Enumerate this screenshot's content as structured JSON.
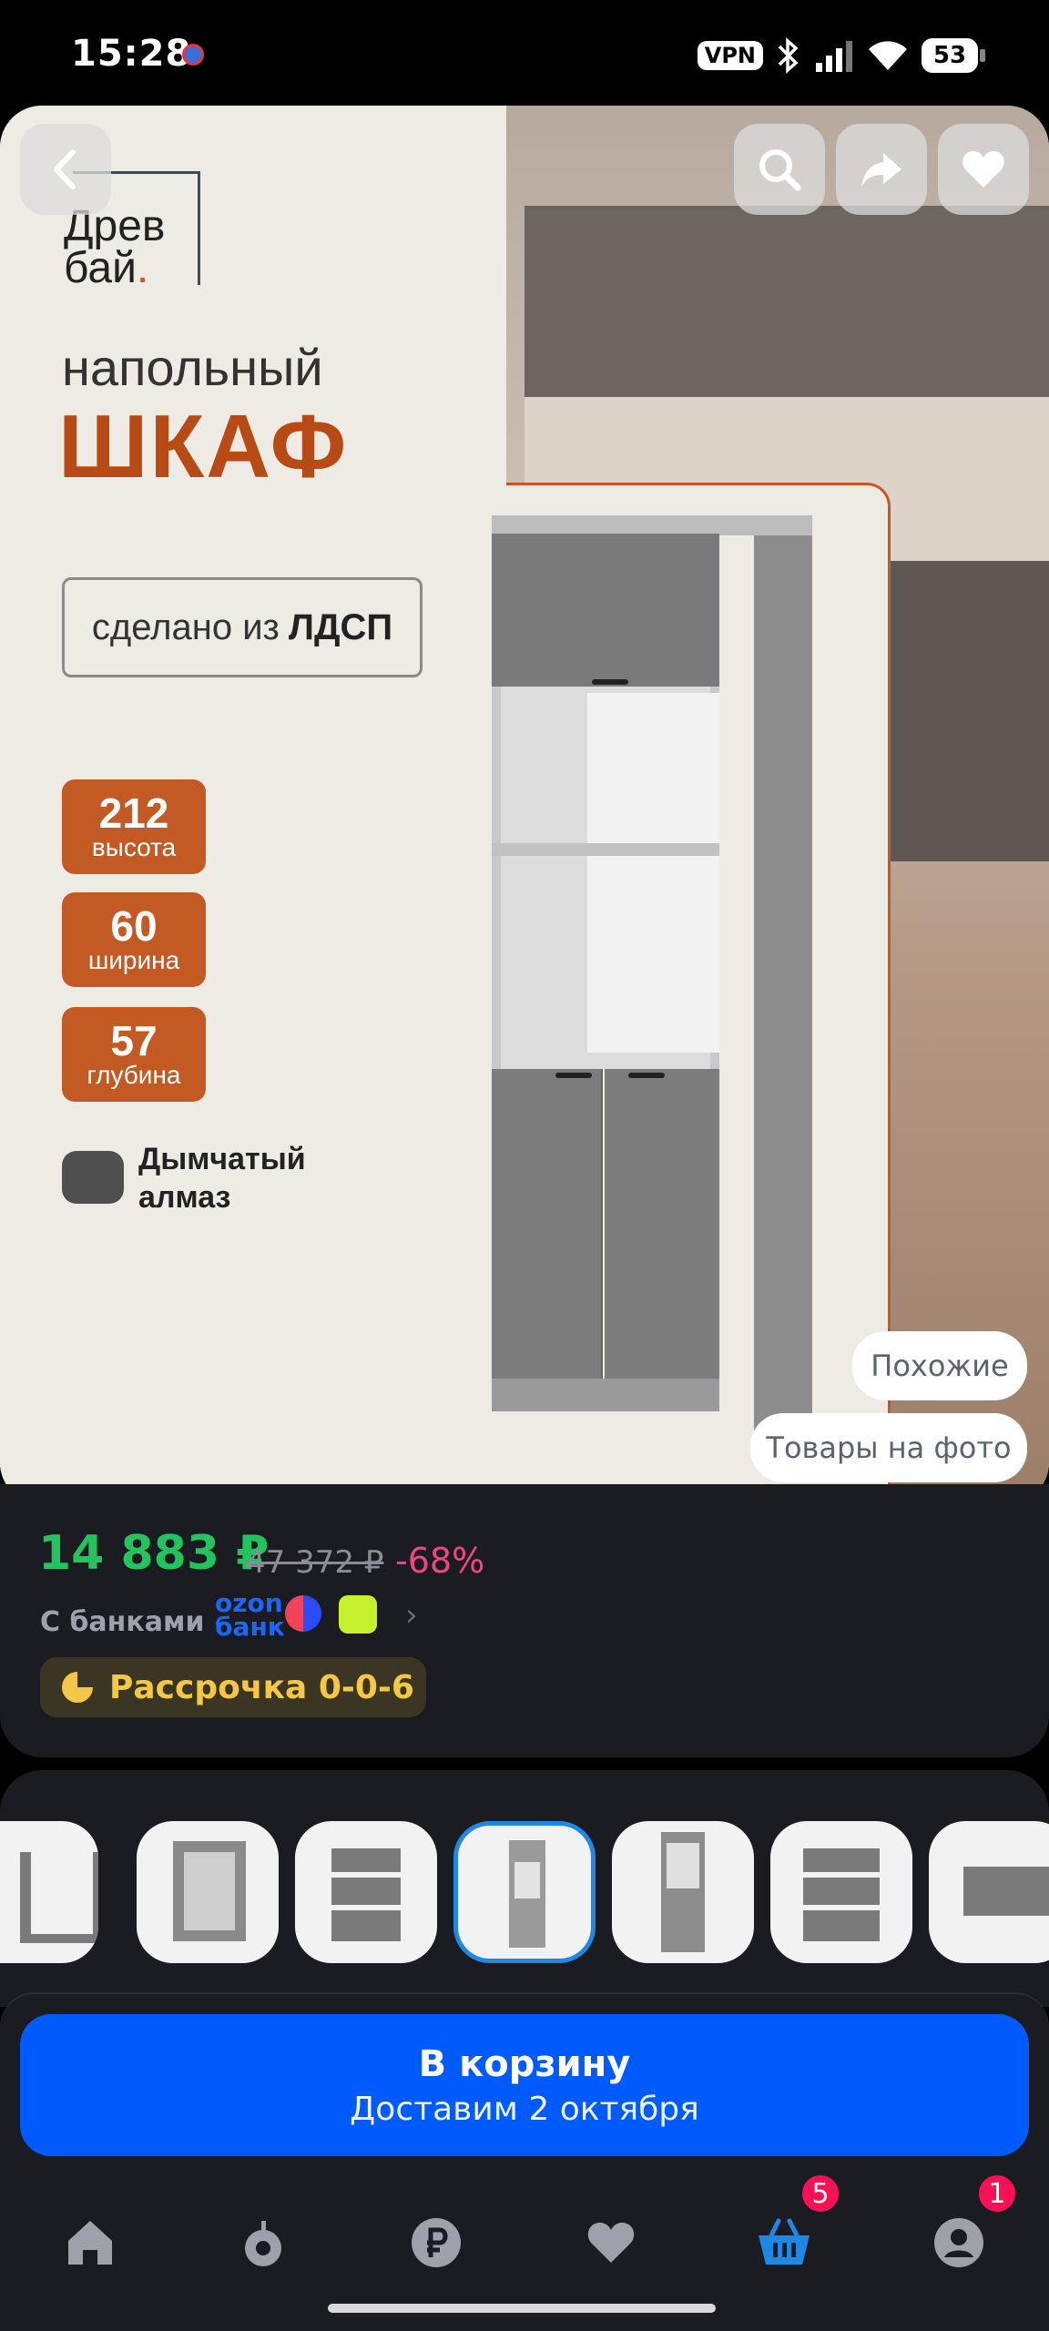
{
  "status_bar": {
    "time": "15:28",
    "vpn": "VPN",
    "battery": "53"
  },
  "hero": {
    "brand_line1": "Древ",
    "brand_line2": "бай",
    "heading_small": "напольный",
    "heading_big": "ШКАФ",
    "made_of_prefix": "сделано из",
    "made_of_material": "ЛДСП",
    "dimensions": [
      {
        "value": "212",
        "label": "высота"
      },
      {
        "value": "60",
        "label": "ширина"
      },
      {
        "value": "57",
        "label": "глубина"
      }
    ],
    "color_name_line1": "Дымчатый",
    "color_name_line2": "алмаз",
    "similar_label": "Похожие",
    "photo_items_label": "Товары на фото"
  },
  "price": {
    "current": "14 883 ₽",
    "old": "47 372 ₽",
    "discount": "-68%",
    "banks_label": "С банками",
    "ozon_bank_line1": "ozon",
    "ozon_bank_line2": "банк",
    "installment_label": "Рассрочка 0-0-6"
  },
  "cart": {
    "button_label": "В корзину",
    "delivery_text": "Доставим 2 октября"
  },
  "nav": {
    "cart_badge": "5",
    "profile_badge": "1"
  },
  "colors": {
    "accent_blue": "#005bff",
    "price_green": "#21c45d",
    "discount_pink": "#f2467f",
    "brand_orange": "#c45a23",
    "installment_yellow": "#f4c846"
  }
}
